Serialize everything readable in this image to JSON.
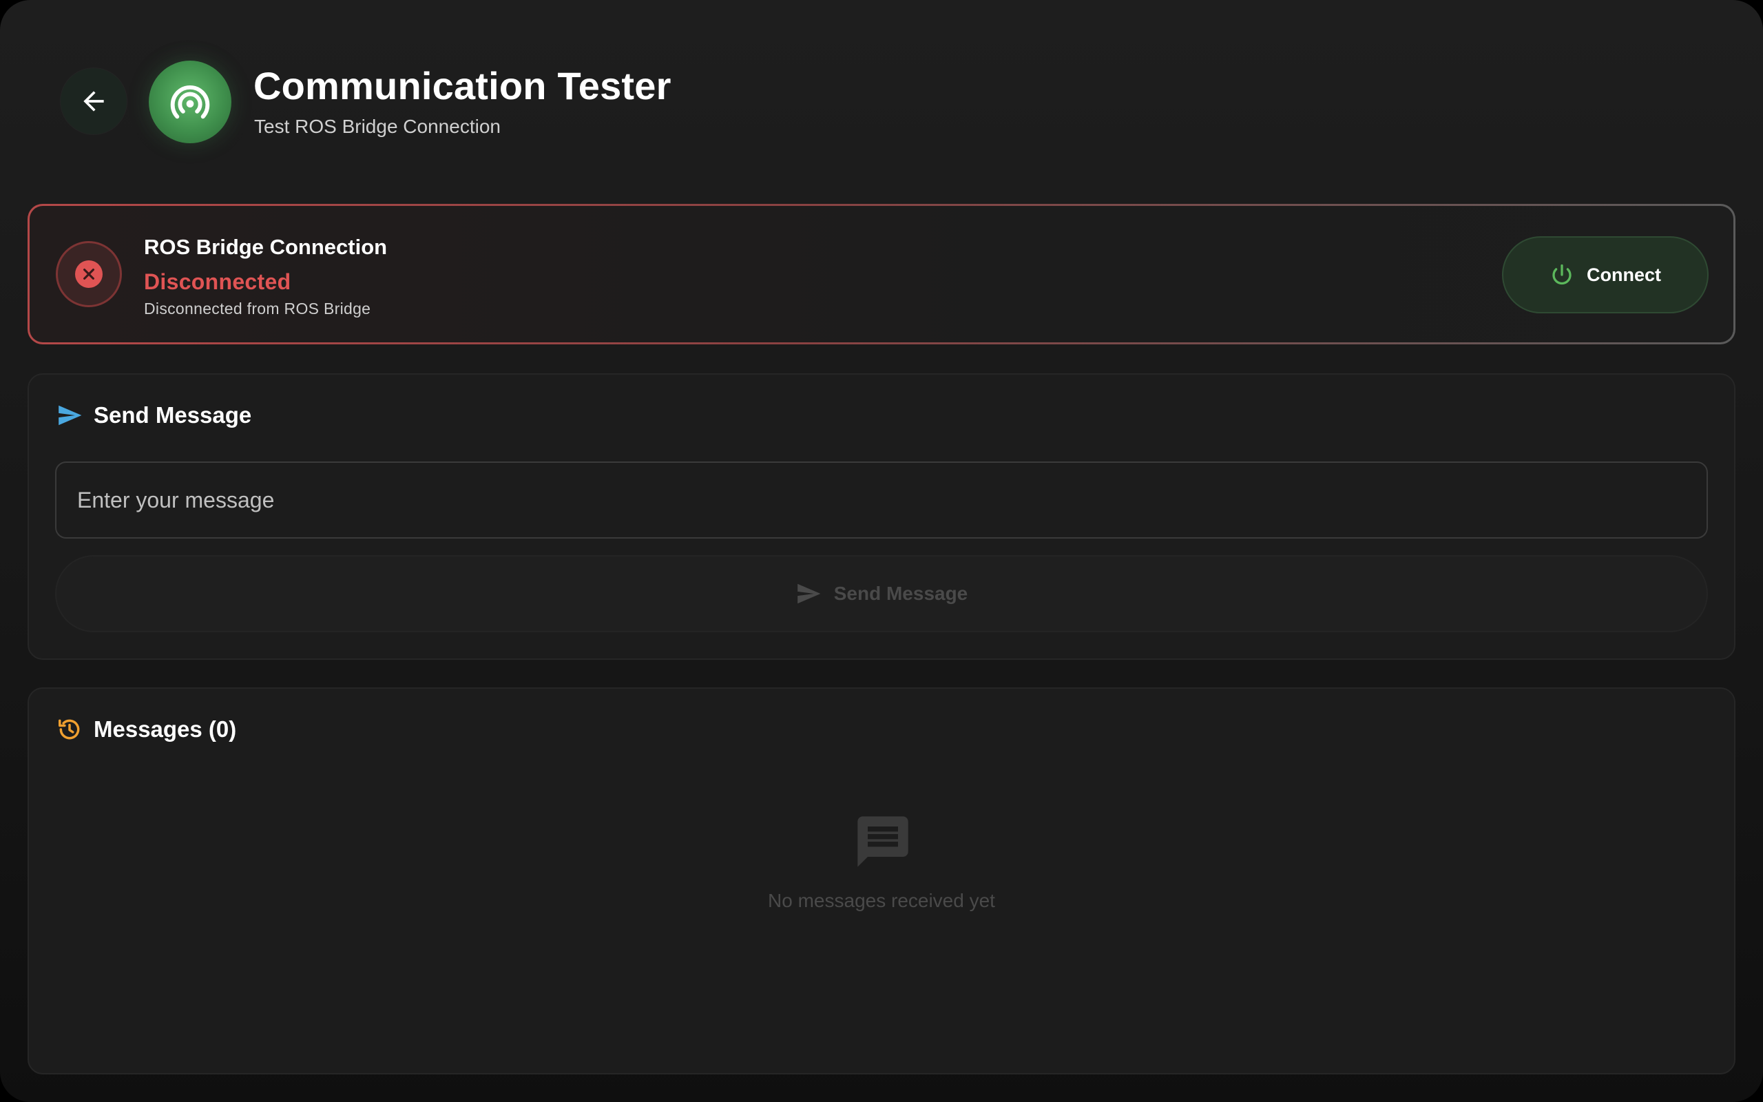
{
  "header": {
    "title": "Communication Tester",
    "subtitle": "Test ROS Bridge Connection",
    "back_icon": "arrow-left-icon",
    "app_icon": "broadcast-icon"
  },
  "connection": {
    "title": "ROS Bridge Connection",
    "status": "Disconnected",
    "detail": "Disconnected from ROS Bridge",
    "status_icon": "error-x-icon",
    "status_color": "#e05454",
    "connect_label": "Connect",
    "connect_icon": "power-icon",
    "connect_icon_color": "#5cb85c"
  },
  "send": {
    "title": "Send Message",
    "title_icon": "send-icon",
    "title_icon_color": "#4aa8e0",
    "input_placeholder": "Enter your message",
    "input_value": "",
    "button_label": "Send Message"
  },
  "messages": {
    "title": "Messages (0)",
    "title_icon": "history-icon",
    "title_icon_color": "#f0a030",
    "empty_icon": "chat-bubble-icon",
    "empty_text": "No messages received yet"
  }
}
